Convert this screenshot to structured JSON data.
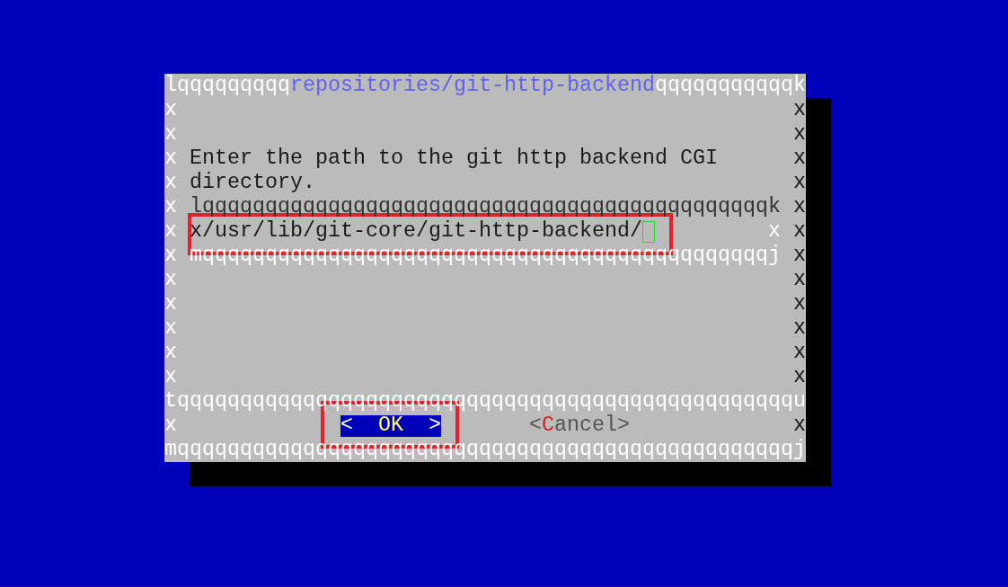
{
  "dialog": {
    "top_border": {
      "left": "lqqqqqqqqq",
      "title": "repositories/git-http-backend",
      "right": "qqqqqqqqqqqk"
    },
    "rows": [
      {
        "kind": "blank",
        "left": "x",
        "right": "x"
      },
      {
        "kind": "blank",
        "left": "x",
        "right": "x"
      },
      {
        "kind": "text",
        "left": "x",
        "text": "Enter the path to the git http backend CGI",
        "right": "x"
      },
      {
        "kind": "text",
        "left": "x",
        "text": "directory.",
        "right": "x"
      },
      {
        "kind": "input_top",
        "left": "x",
        "border": "lqqqqqqqqqqqqqqqqqqqqqqqqqqqqqqqqqqqqqqqqqqqqqk",
        "right": "x"
      },
      {
        "kind": "input",
        "left": "x",
        "field_left": "x",
        "value": "/usr/lib/git-core/git-http-backend/",
        "field_right": "x",
        "right": "x"
      },
      {
        "kind": "input_bottom",
        "left": "x",
        "border": "mqqqqqqqqqqqqqqqqqqqqqqqqqqqqqqqqqqqqqqqqqqqqqj",
        "right": "x"
      },
      {
        "kind": "blank",
        "left": "x",
        "right": "x"
      },
      {
        "kind": "blank",
        "left": "x",
        "right": "x"
      },
      {
        "kind": "blank",
        "left": "x",
        "right": "x"
      },
      {
        "kind": "blank",
        "left": "x",
        "right": "x"
      },
      {
        "kind": "blank",
        "left": "x",
        "right": "x"
      }
    ],
    "separator": "tqqqqqqqqqqqqqqqqqqqqqqqqqqqqqqqqqqqqqqqqqqqqqqqqqu",
    "button_row": {
      "left": "x",
      "right": "x",
      "buttons": [
        {
          "open": "<",
          "label": "OK",
          "close": ">",
          "selected": true
        },
        {
          "open": "<",
          "label": "Cancel",
          "close": ">",
          "selected": false
        }
      ]
    },
    "bottom_border": "mqqqqqqqqqqqqqqqqqqqqqqqqqqqqqqqqqqqqqqqqqqqqqqqqqj"
  }
}
